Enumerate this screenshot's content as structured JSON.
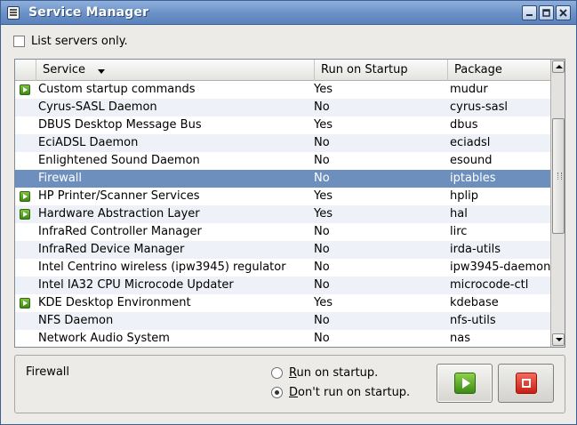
{
  "window": {
    "title": "Service Manager",
    "controls": {
      "minimize": "minimize-icon",
      "maximize": "maximize-icon",
      "close": "close-icon"
    }
  },
  "filter": {
    "label": "List servers only.",
    "checked": false
  },
  "table": {
    "columns": {
      "service": "Service",
      "run": "Run on Startup",
      "package": "Package"
    },
    "sort": {
      "column": "Service",
      "direction": "descending-arrow"
    },
    "rows": [
      {
        "running": true,
        "service": "Custom startup commands",
        "run": "Yes",
        "package": "mudur"
      },
      {
        "running": false,
        "service": "Cyrus-SASL Daemon",
        "run": "No",
        "package": "cyrus-sasl"
      },
      {
        "running": false,
        "service": "DBUS Desktop Message Bus",
        "run": "Yes",
        "package": "dbus"
      },
      {
        "running": false,
        "service": "EciADSL Daemon",
        "run": "No",
        "package": "eciadsl"
      },
      {
        "running": false,
        "service": "Enlightened Sound Daemon",
        "run": "No",
        "package": "esound"
      },
      {
        "running": false,
        "service": "Firewall",
        "run": "No",
        "package": "iptables",
        "selected": true
      },
      {
        "running": true,
        "service": "HP Printer/Scanner Services",
        "run": "Yes",
        "package": "hplip"
      },
      {
        "running": true,
        "service": "Hardware Abstraction Layer",
        "run": "Yes",
        "package": "hal"
      },
      {
        "running": false,
        "service": "InfraRed Controller Manager",
        "run": "No",
        "package": "lirc"
      },
      {
        "running": false,
        "service": "InfraRed Device Manager",
        "run": "No",
        "package": "irda-utils"
      },
      {
        "running": false,
        "service": "Intel Centrino wireless (ipw3945) regulator",
        "run": "No",
        "package": "ipw3945-daemon"
      },
      {
        "running": false,
        "service": "Intel IA32 CPU Microcode Updater",
        "run": "No",
        "package": "microcode-ctl"
      },
      {
        "running": true,
        "service": "KDE Desktop Environment",
        "run": "Yes",
        "package": "kdebase"
      },
      {
        "running": false,
        "service": "NFS Daemon",
        "run": "No",
        "package": "nfs-utils"
      },
      {
        "running": false,
        "service": "Network Audio System",
        "run": "No",
        "package": "nas"
      }
    ]
  },
  "details": {
    "selected_service": "Firewall",
    "option_run": {
      "accel": "R",
      "rest": "un on startup."
    },
    "option_dont": {
      "accel": "D",
      "rest": "on't run on startup."
    },
    "selected_option": "dont",
    "start_icon": "play-icon",
    "stop_icon": "stop-icon"
  },
  "colors": {
    "titlebar": "#6a90c6",
    "selection": "#6c8fbd",
    "running_indicator": "#3f8a17",
    "stop_button": "#c81f12"
  }
}
